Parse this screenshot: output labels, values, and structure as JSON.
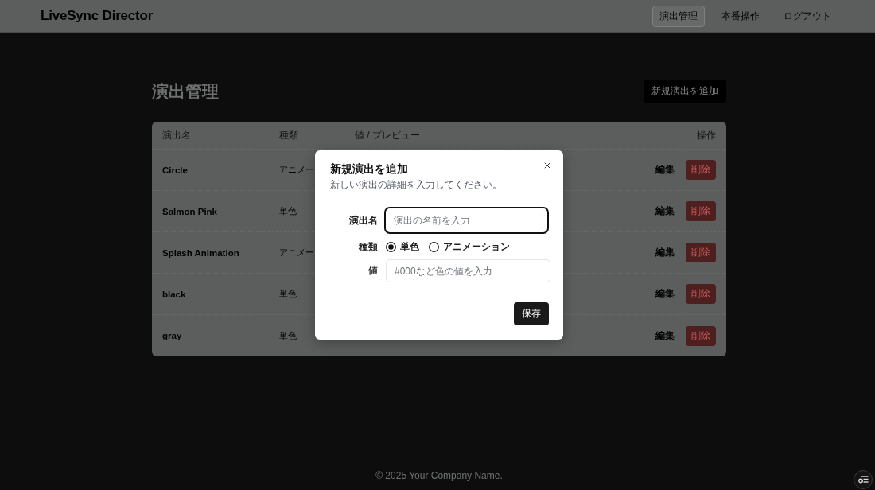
{
  "header": {
    "logo": "LiveSync Director",
    "nav": [
      {
        "label": "演出管理",
        "selected": true
      },
      {
        "label": "本番操作",
        "selected": false
      },
      {
        "label": "ログアウト",
        "selected": false
      }
    ]
  },
  "page": {
    "title": "演出管理",
    "add_button": "新規演出を追加"
  },
  "table": {
    "columns": [
      "演出名",
      "種類",
      "値 / プレビュー",
      "操作"
    ],
    "rows": [
      {
        "name": "Circle",
        "type": "アニメー",
        "edit": "編集",
        "delete": "削除"
      },
      {
        "name": "Salmon Pink",
        "type": "単色",
        "edit": "編集",
        "delete": "削除"
      },
      {
        "name": "Splash Animation",
        "type": "アニメー",
        "edit": "編集",
        "delete": "削除"
      },
      {
        "name": "black",
        "type": "単色",
        "edit": "編集",
        "delete": "削除"
      },
      {
        "name": "gray",
        "type": "単色",
        "edit": "編集",
        "delete": "削除"
      }
    ]
  },
  "dialog": {
    "title": "新規演出を追加",
    "description": "新しい演出の詳細を入力してください。",
    "fields": [
      {
        "kind": "text",
        "label": "演出名",
        "placeholder": "演出の名前を入力",
        "focused": true
      },
      {
        "kind": "radio",
        "label": "種類",
        "options": [
          {
            "label": "単色",
            "selected": true
          },
          {
            "label": "アニメーション",
            "selected": false
          }
        ]
      },
      {
        "kind": "text",
        "label": "値",
        "placeholder": "#000など色の値を入力",
        "focused": false
      }
    ],
    "save": "保存"
  },
  "footer": {
    "copyright": "© 2025 Your Company Name."
  }
}
